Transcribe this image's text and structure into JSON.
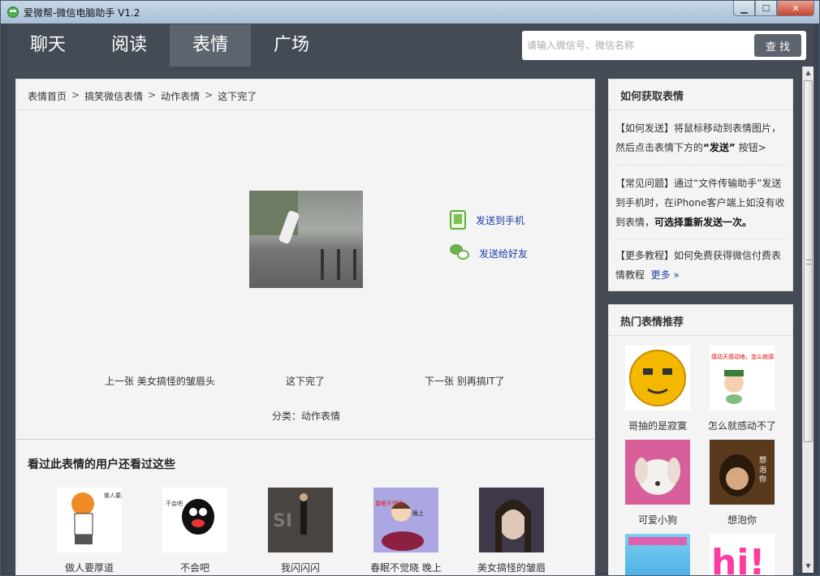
{
  "window": {
    "title": "爱微帮-微信电脑助手 V1.2",
    "min_label": "▁",
    "max_label": "☐",
    "close_label": "✕"
  },
  "nav": {
    "tabs": [
      {
        "label": "聊天"
      },
      {
        "label": "阅读"
      },
      {
        "label": "表情"
      },
      {
        "label": "广场"
      }
    ],
    "active_index": 2
  },
  "search": {
    "placeholder": "请输入微信号、微信名称",
    "button_label": "查 找"
  },
  "breadcrumb": {
    "items": [
      "表情首页",
      "搞笑微信表情",
      "动作表情",
      "这下完了"
    ],
    "separator": ">"
  },
  "detail": {
    "send_phone_label": "发送到手机",
    "send_friend_label": "发送给好友",
    "prev_label": "上一张 美女搞怪的皱眉头",
    "current_label": "这下完了",
    "next_label": "下一张 别再搞IT了",
    "category_label": "分类：动作表情"
  },
  "related": {
    "title": "看过此表情的用户还看过这些",
    "items": [
      {
        "label": "做人要厚道"
      },
      {
        "label": "不会吧"
      },
      {
        "label": "我闪闪闪"
      },
      {
        "label": "春眠不觉晓 晚上"
      },
      {
        "label": "美女搞怪的皱眉"
      }
    ]
  },
  "howto": {
    "title": "如何获取表情",
    "tip1_prefix": "【如何发送】将鼠标移动到表情图片，然后点击表情下方的",
    "tip1_bold": "“发送”",
    "tip1_suffix": "按钮>",
    "tip2_prefix": "【常见问题】通过“文件传输助手”发送到手机时，在iPhone客户端上如没有收到表情，",
    "tip2_bold": "可选择重新发送一次。",
    "tip3_prefix": "【更多教程】如何免费获得微信付费表情教程",
    "tip3_more": "更多 »"
  },
  "hot": {
    "title": "热门表情推荐",
    "items": [
      {
        "label": "哥抽的是寂寞"
      },
      {
        "label": "怎么就感动不了"
      },
      {
        "label": "可爱小狗"
      },
      {
        "label": "想泡你"
      }
    ],
    "img_text_2": "感动天感动地，怎么就感动不了你!",
    "img_text_4": "想 泡 你",
    "img_text_6": "hi!"
  },
  "related_img_text": {
    "r1": "做人要厚道",
    "r2": "不会吧",
    "r4": "春眠不觉晓",
    "r4_bubble": "晚上"
  },
  "colors": {
    "nav_bg": "#454b55",
    "nav_active": "#5d646e",
    "link": "#1e3ea6",
    "accent_green": "#6ab04c"
  },
  "scrollbar": {
    "up": "▲",
    "down": "▼"
  }
}
